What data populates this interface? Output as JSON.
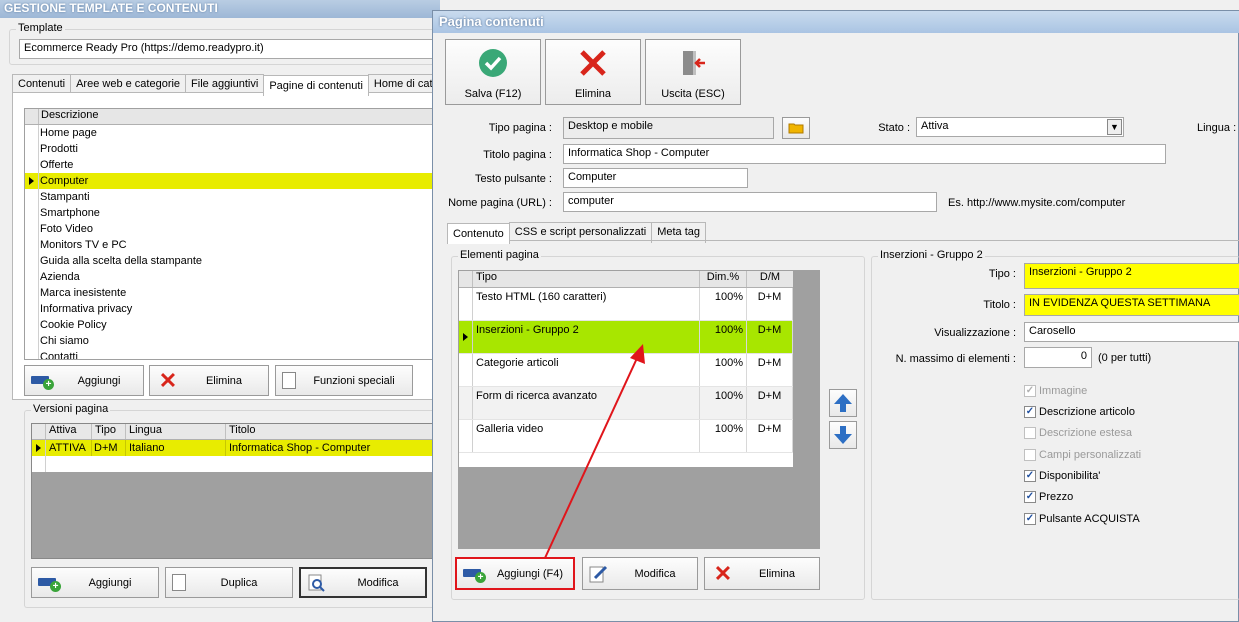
{
  "bg": {
    "title": "GESTIONE TEMPLATE E CONTENUTI",
    "template_group_label": "Template",
    "template_value": "Ecommerce Ready Pro (https://demo.readypro.it)",
    "tabs": [
      "Contenuti",
      "Aree web e categorie",
      "File aggiuntivi",
      "Pagine di contenuti",
      "Home di catego"
    ],
    "pages_header": "Descrizione",
    "pages": [
      "Home page",
      "Prodotti",
      "Offerte",
      "Computer",
      "Stampanti",
      "Smartphone",
      "Foto Video",
      "Monitors TV e PC",
      "Guida alla scelta della stampante",
      "Azienda",
      "Marca inesistente",
      "Informativa privacy",
      "Cookie Policy",
      "Chi siamo",
      "Contatti"
    ],
    "buttons": {
      "add": "Aggiungi",
      "delete": "Elimina",
      "special": "Funzioni speciali"
    },
    "versions_label": "Versioni pagina",
    "versions_headers": [
      "Attiva",
      "Tipo",
      "Lingua",
      "Titolo"
    ],
    "versions_row": [
      "ATTIVA",
      "D+M",
      "Italiano",
      "Informatica Shop - Computer"
    ],
    "bottom_buttons": {
      "add": "Aggiungi",
      "duplicate": "Duplica",
      "edit": "Modifica"
    }
  },
  "dlg": {
    "title": "Pagina contenuti",
    "toolbar": {
      "save": "Salva (F12)",
      "delete": "Elimina",
      "exit": "Uscita (ESC)"
    },
    "tipo_pagina_label": "Tipo pagina :",
    "tipo_pagina_value": "Desktop e mobile",
    "stato_label": "Stato :",
    "stato_value": "Attiva",
    "lingua_label": "Lingua :",
    "titolo_pagina_label": "Titolo pagina :",
    "titolo_pagina_value": "Informatica Shop - Computer",
    "testo_pulsante_label": "Testo pulsante :",
    "testo_pulsante_value": "Computer",
    "nome_pagina_label": "Nome pagina (URL) :",
    "nome_pagina_value": "computer",
    "url_example": "Es. http://www.mysite.com/computer",
    "tabs": [
      "Contenuto",
      "CSS e script personalizzati",
      "Meta tag"
    ],
    "elements_label": "Elementi pagina",
    "elements_headers": [
      "Tipo",
      "Dim.%",
      "D/M"
    ],
    "elements": [
      {
        "tipo": "Testo HTML (160 caratteri)",
        "dim": "100%",
        "dm": "D+M"
      },
      {
        "tipo": "Inserzioni - Gruppo 2",
        "dim": "100%",
        "dm": "D+M"
      },
      {
        "tipo": "Categorie articoli",
        "dim": "100%",
        "dm": "D+M"
      },
      {
        "tipo": "Form di ricerca avanzato",
        "dim": "100%",
        "dm": "D+M"
      },
      {
        "tipo": "Galleria video",
        "dim": "100%",
        "dm": "D+M"
      }
    ],
    "buttons": {
      "add": "Aggiungi (F4)",
      "edit": "Modifica",
      "delete": "Elimina"
    },
    "right_group_label": "Inserzioni - Gruppo 2",
    "right": {
      "tipo_label": "Tipo :",
      "tipo_value": "Inserzioni - Gruppo 2",
      "titolo_label": "Titolo :",
      "titolo_value": "IN EVIDENZA QUESTA SETTIMANA",
      "vis_label": "Visualizzazione :",
      "vis_value": "Carosello",
      "max_label": "N. massimo di elementi :",
      "max_value": "0",
      "max_hint": "(0 per tutti)"
    },
    "checks": [
      {
        "label": "Immagine",
        "checked": true,
        "disabled": true
      },
      {
        "label": "Descrizione articolo",
        "checked": true,
        "disabled": false
      },
      {
        "label": "Descrizione estesa",
        "checked": false,
        "disabled": true
      },
      {
        "label": "Campi personalizzati",
        "checked": false,
        "disabled": true
      },
      {
        "label": "Disponibilita'",
        "checked": true,
        "disabled": false
      },
      {
        "label": "Prezzo",
        "checked": true,
        "disabled": false
      },
      {
        "label": "Pulsante ACQUISTA",
        "checked": true,
        "disabled": false
      }
    ]
  },
  "colors": {
    "selected_row": "#e8ec00",
    "selected_element": "#a8e600",
    "highlight_field": "#ffff00",
    "annotation": "#e0151b"
  }
}
